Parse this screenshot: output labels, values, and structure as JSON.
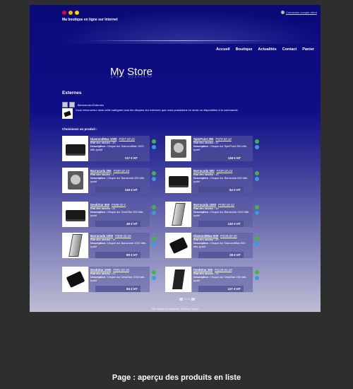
{
  "header": {
    "tagline": "Ma boutique en ligne sur Internet",
    "login_link": "Connexion compte client",
    "flags": [
      "#c8102e",
      "#f7b500",
      "#ffd700"
    ]
  },
  "nav": {
    "items": [
      "Accueil",
      "Boutique",
      "Actualités",
      "Contact",
      "Panier"
    ]
  },
  "logo": {
    "text": "My Store"
  },
  "page": {
    "section_title": "Externes",
    "breadcrumb": "Bienvenue>Externes",
    "intro": "Vous retrouverez dans cette catégorie tous les disques dur externes que nous possédons en stock ou disponibles à la commande.",
    "choose_label": "Choisissez un produit :"
  },
  "labels": {
    "stock": "Etat des stocks :",
    "description": "Description :"
  },
  "products": [
    {
      "name": "DiamondMax 1000",
      "ref": "P327-02-21",
      "stock": "39",
      "desc": "Disque dur DiamondMax 1000 tdttr-tyuthf",
      "price": "117 €  HT",
      "icon": "hd-box"
    },
    {
      "name": "SpinPoint 250",
      "ref": "P470-02-22",
      "stock": "41",
      "desc": "Disque dur SpinPoint 250 tdttr-tyuthf",
      "price": "118 €  HT",
      "icon": "hd-open"
    },
    {
      "name": "Barracuda 250",
      "ref": "P349-02-23",
      "stock": "1",
      "desc": "Disque dur Barracuda 250 tdttr-tyuthf",
      "price": "118 €  HT",
      "icon": "hd-open"
    },
    {
      "name": "Barracuda 500",
      "ref": "P239-02-24",
      "stock": "15",
      "desc": "Disque dur Barracuda 500 tdttr-tyuthf",
      "price": "64 €  HT",
      "icon": "hd-box"
    },
    {
      "name": "DeskStar 500",
      "ref": "P496-02-2",
      "stock": "41",
      "desc": "Disque dur DeskStar 500 tdttr-tyuthf",
      "price": "49 €  HT",
      "icon": "hd-box"
    },
    {
      "name": "Barracuda 1000",
      "ref": "PV02-02-12",
      "stock": "30",
      "desc": "Disque dur Barracuda 1000 tdttr-tyuthf",
      "price": "140 €  HT",
      "icon": "hd-stand"
    },
    {
      "name": "Barracuda 1000",
      "ref": "P369-02-25",
      "stock": "15",
      "desc": "Disque dur Barracuda 1000 tdttr-tyuthf",
      "price": "90 €  HT",
      "icon": "hd-stand"
    },
    {
      "name": "DiamondMax 500",
      "ref": "P1O5-02-20",
      "stock": "39",
      "desc": "Disque dur DiamondMax 500 tdttr-tyuthf",
      "price": "28 €  HT",
      "icon": "hd-flat"
    },
    {
      "name": "DeskStar 1000",
      "ref": "P901-02-18",
      "stock": "21",
      "desc": "Disque dur DeskStar 1000 tdttr-tyuthf",
      "price": "84 €  HT",
      "icon": "hd-flat"
    },
    {
      "name": "DeskStar 250",
      "ref": "P1149-02-19",
      "stock": "19",
      "desc": "Disque dur DeskStar 250 tdttr-tyuthf",
      "price": "127 €  HT",
      "icon": "hd-tall"
    }
  ],
  "pager": {
    "text": "1 / 2"
  },
  "footer": {
    "text": "Site réalisé sur Wsboutic - Wsshop Hopine"
  },
  "caption": "Page : aperçu des produits en liste"
}
